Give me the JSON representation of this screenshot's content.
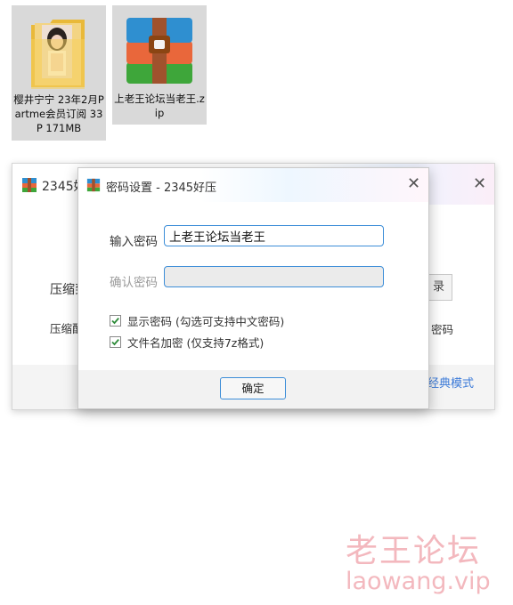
{
  "desktop": {
    "files": [
      {
        "name": "樱井宁宁 23年2月Partme会员订阅 33P 171MB",
        "icon": "folder-icon",
        "selected": true
      },
      {
        "name": "上老王论坛当老王.zip",
        "icon": "zip-archive-icon",
        "selected": true
      }
    ]
  },
  "back_window": {
    "title": "2345好",
    "close_glyph": "✕",
    "label_compress": "压缩到",
    "label_compress_mode": "压缩配",
    "button_partial": "录",
    "right_text": "密码",
    "classic_mode": "经典模式"
  },
  "dialog": {
    "title": "密码设置 - 2345好压",
    "close_glyph": "✕",
    "password_label": "输入密码",
    "password_value": "上老王论坛当老王",
    "confirm_label": "确认密码",
    "confirm_value": "",
    "show_password_label": "显示密码 (勾选可支持中文密码)",
    "show_password_checked": true,
    "encrypt_filenames_label": "文件名加密 (仅支持7z格式)",
    "encrypt_filenames_checked": true,
    "ok_label": "确定"
  },
  "watermark": {
    "cn": "老王论坛",
    "url": "laowang.vip"
  },
  "colors": {
    "accent": "#3d8ed8",
    "link": "#3b7ad8",
    "watermark": "#f3b8be",
    "checkmark": "#2e8b3a"
  }
}
